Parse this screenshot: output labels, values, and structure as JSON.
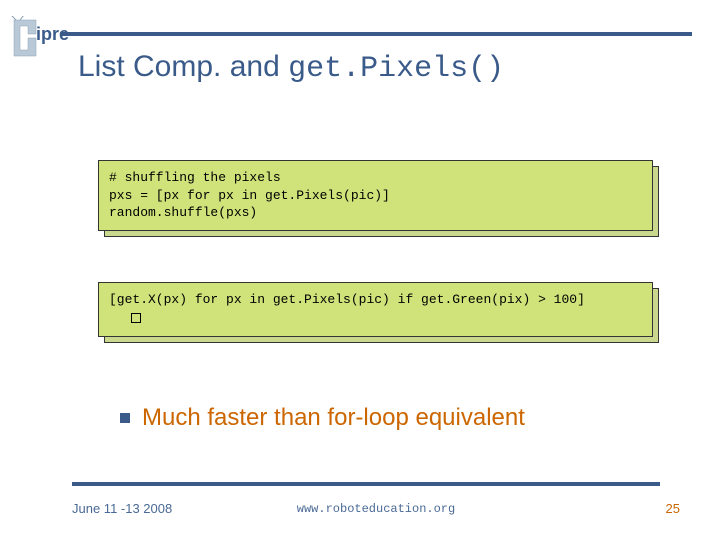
{
  "logo_text": "ipre",
  "title_prefix": "List Comp. and ",
  "title_code": "get.Pixels()",
  "code_block_1": "# shuffling the pixels\npxs = [px for px in get.Pixels(pic)]\nrandom.shuffle(pxs)",
  "code_block_2": "[get.X(px) for px in get.Pixels(pic) if get.Green(pix) > 100]",
  "bullet_text": "Much faster than for-loop equivalent",
  "footer_date": "June 11 -13 2008",
  "footer_url": "www.roboteducation.org",
  "page_number": "25"
}
